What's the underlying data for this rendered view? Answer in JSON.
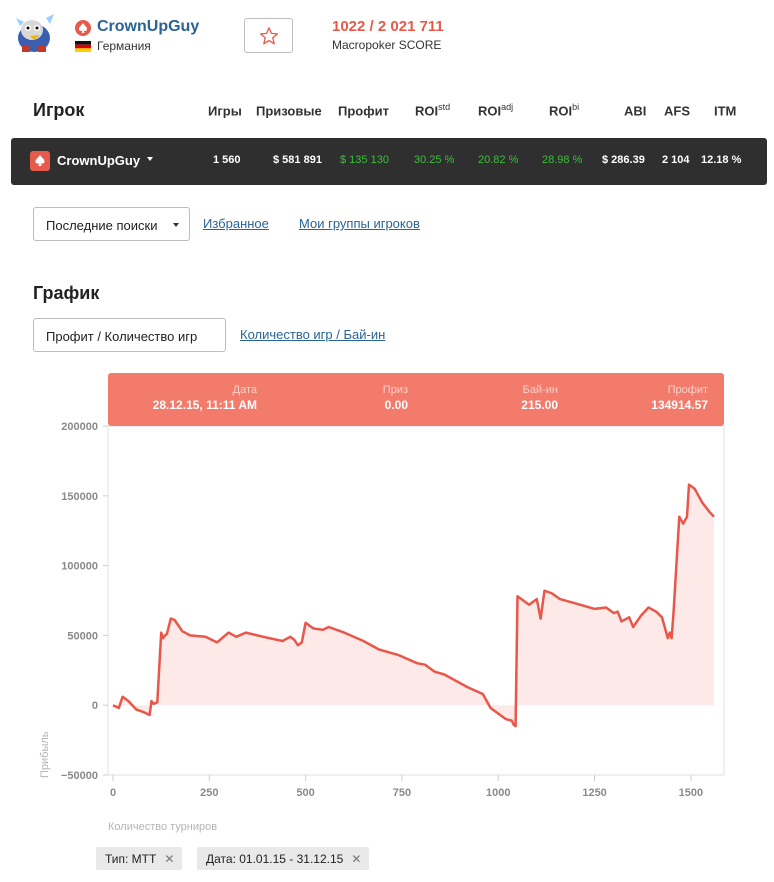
{
  "header": {
    "player_name": "CrownUpGuy",
    "country": "Германия",
    "score_value": "1022 / 2 021 711",
    "score_label": "Macropoker SCORE"
  },
  "table": {
    "section_title": "Игрок",
    "columns": [
      {
        "label": "Игры",
        "sup": ""
      },
      {
        "label": "Призовые",
        "sup": ""
      },
      {
        "label": "Профит",
        "sup": ""
      },
      {
        "label": "ROI",
        "sup": "std"
      },
      {
        "label": "ROI",
        "sup": "adj"
      },
      {
        "label": "ROI",
        "sup": "bi"
      },
      {
        "label": "ABI",
        "sup": ""
      },
      {
        "label": "AFS",
        "sup": ""
      },
      {
        "label": "ITM",
        "sup": ""
      }
    ],
    "row": {
      "name": "CrownUpGuy",
      "values": [
        "1 560",
        "$ 581 891",
        "$ 135 130",
        "30.25 %",
        "20.82 %",
        "28.98 %",
        "$ 286.39",
        "2 104",
        "12.18 %"
      ],
      "green_indices": [
        2,
        3,
        4,
        5
      ]
    }
  },
  "filters": {
    "recent_label": "Последние поиски",
    "favorites_label": "Избранное",
    "groups_label": "Мои группы игроков"
  },
  "graph": {
    "section_title": "График",
    "tab_active": "Профит / Количество игр",
    "tab_other": "Количество игр / Бай-ин"
  },
  "tooltip": {
    "date_label": "Дата",
    "date_value": "28.12.15, 11:11 AM",
    "prize_label": "Приз",
    "prize_value": "0.00",
    "buyin_label": "Бай-ин",
    "buyin_value": "215.00",
    "profit_label": "Профит",
    "profit_value": "134914.57"
  },
  "chips": [
    {
      "label": "Тип: MTT"
    },
    {
      "label": "Дата: 01.01.15 - 31.12.15"
    }
  ],
  "colors": {
    "accent": "#e55a4b",
    "line": "#e8574a",
    "area": "#fdeae8",
    "green": "#3bbf3b",
    "dark_row": "#2f2f2f",
    "link": "#2a6496"
  },
  "chart_data": {
    "type": "area",
    "xlabel": "Количество турниров",
    "ylabel": "Прибыль",
    "xlim": [
      0,
      1560
    ],
    "ylim": [
      -50000,
      200000
    ],
    "x_ticks": [
      0,
      250,
      500,
      750,
      1000,
      1250,
      1500
    ],
    "y_ticks": [
      -50000,
      0,
      50000,
      100000,
      150000,
      200000
    ],
    "y_tick_labels": [
      "−50000",
      "0",
      "50000",
      "100000",
      "150000",
      "200000"
    ],
    "series": [
      {
        "x": [
          0,
          15,
          25,
          40,
          60,
          80,
          95,
          100,
          105,
          115,
          125,
          130,
          135,
          140,
          150,
          160,
          170,
          180,
          200,
          240,
          270,
          300,
          320,
          345,
          390,
          440,
          460,
          470,
          480,
          490,
          500,
          520,
          545,
          560,
          600,
          650,
          690,
          740,
          790,
          810,
          820,
          835,
          860,
          900,
          920,
          960,
          980,
          1000,
          1020,
          1035,
          1040,
          1045,
          1050,
          1080,
          1100,
          1110,
          1120,
          1140,
          1150,
          1160,
          1200,
          1250,
          1280,
          1300,
          1310,
          1320,
          1340,
          1350,
          1370,
          1390,
          1410,
          1425,
          1440,
          1445,
          1450,
          1455,
          1470,
          1480,
          1490,
          1495,
          1510,
          1530,
          1550,
          1560
        ],
        "y": [
          0,
          -2000,
          6000,
          3000,
          -3000,
          -5000,
          -7000,
          3000,
          1000,
          2000,
          52000,
          48000,
          50000,
          51000,
          62000,
          61000,
          57000,
          53000,
          50000,
          49000,
          45000,
          52000,
          49000,
          52000,
          49000,
          46000,
          49000,
          47000,
          43000,
          45000,
          59000,
          55000,
          54000,
          56000,
          52000,
          46000,
          40000,
          36000,
          30000,
          29000,
          27000,
          24000,
          22000,
          16000,
          13000,
          8000,
          -2000,
          -6000,
          -10000,
          -11000,
          -14000,
          -15000,
          78000,
          72000,
          76000,
          62000,
          82000,
          80000,
          78000,
          76000,
          73000,
          69000,
          70000,
          66000,
          67000,
          60000,
          63000,
          56000,
          64000,
          70000,
          67000,
          63000,
          48000,
          52000,
          48000,
          66000,
          135000,
          130000,
          135000,
          158000,
          155000,
          145000,
          138000,
          135000
        ]
      }
    ]
  }
}
